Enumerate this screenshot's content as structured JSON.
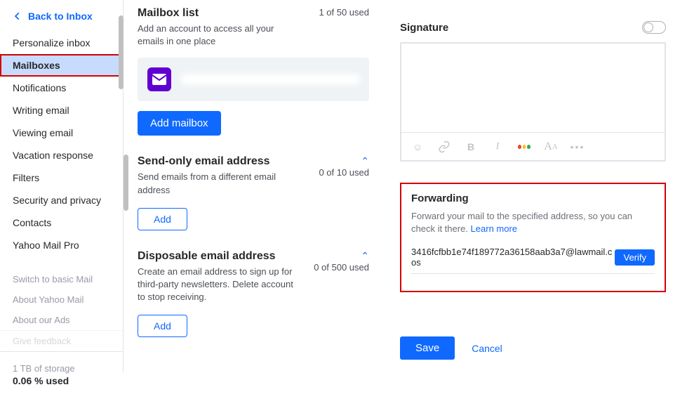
{
  "sidebar": {
    "back": "Back to Inbox",
    "items": [
      "Personalize inbox",
      "Mailboxes",
      "Notifications",
      "Writing email",
      "Viewing email",
      "Vacation response",
      "Filters",
      "Security and privacy",
      "Contacts",
      "Yahoo Mail Pro"
    ],
    "secondary": [
      "Switch to basic Mail",
      "About Yahoo Mail",
      "About our Ads",
      "Give feedback"
    ],
    "storage": {
      "line1": "1 TB of storage",
      "line2": "0.06 % used"
    }
  },
  "middle": {
    "mailboxList": {
      "title": "Mailbox list",
      "desc": "Add an account to access all your emails in one place",
      "used": "1 of 50 used",
      "addBtn": "Add mailbox"
    },
    "sendOnly": {
      "title": "Send-only email address",
      "desc": "Send emails from a different email address",
      "used": "0 of 10 used",
      "addBtn": "Add"
    },
    "disposable": {
      "title": "Disposable email address",
      "desc": "Create an email address to sign up for third-party newsletters. Delete account to stop receiving.",
      "used": "0 of 500 used",
      "addBtn": "Add"
    }
  },
  "right": {
    "signature": {
      "title": "Signature"
    },
    "forwarding": {
      "title": "Forwarding",
      "desc": "Forward your mail to the specified address, so you can check it there. ",
      "learnMore": "Learn more",
      "email": "3416fcfbb1e74f189772a36158aab3a7@lawmail.cos",
      "verify": "Verify"
    },
    "actions": {
      "save": "Save",
      "cancel": "Cancel"
    }
  }
}
